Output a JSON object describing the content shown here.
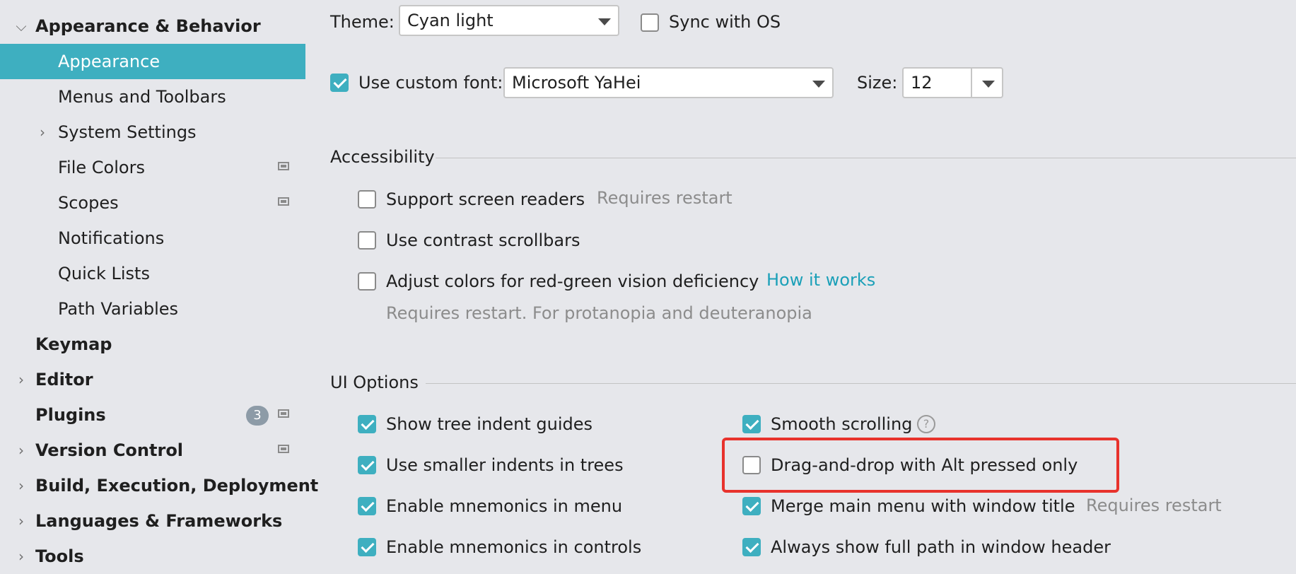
{
  "sidebar": {
    "items": [
      {
        "label": "Appearance & Behavior",
        "expander": "expanded"
      },
      {
        "label": "Appearance"
      },
      {
        "label": "Menus and Toolbars"
      },
      {
        "label": "System Settings",
        "expander": "collapsed"
      },
      {
        "label": "File Colors"
      },
      {
        "label": "Scopes"
      },
      {
        "label": "Notifications"
      },
      {
        "label": "Quick Lists"
      },
      {
        "label": "Path Variables"
      },
      {
        "label": "Keymap"
      },
      {
        "label": "Editor",
        "expander": "collapsed"
      },
      {
        "label": "Plugins",
        "badge": "3"
      },
      {
        "label": "Version Control",
        "expander": "collapsed"
      },
      {
        "label": "Build, Execution, Deployment",
        "expander": "collapsed"
      },
      {
        "label": "Languages & Frameworks",
        "expander": "collapsed"
      },
      {
        "label": "Tools",
        "expander": "collapsed"
      }
    ],
    "arrow_expanded": "⌵",
    "arrow_collapsed": "›"
  },
  "theme": {
    "label": "Theme:",
    "value": "Cyan light",
    "sync_label": "Sync with OS",
    "sync_checked": false
  },
  "font": {
    "label": "Use custom font:",
    "checked": true,
    "value": "Microsoft YaHei",
    "size_label": "Size:",
    "size_value": "12"
  },
  "accessibility": {
    "title": "Accessibility",
    "screen_readers": {
      "label": "Support screen readers",
      "hint": "Requires restart",
      "checked": false
    },
    "contrast_scrollbars": {
      "label": "Use contrast scrollbars",
      "checked": false
    },
    "color_adjust": {
      "label": "Adjust colors for red-green vision deficiency",
      "link": "How it works",
      "hint": "Requires restart. For protanopia and deuteranopia",
      "checked": false
    }
  },
  "ui_options": {
    "title": "UI Options",
    "left": [
      {
        "label": "Show tree indent guides",
        "checked": true
      },
      {
        "label": "Use smaller indents in trees",
        "checked": true
      },
      {
        "label": "Enable mnemonics in menu",
        "checked": true
      },
      {
        "label": "Enable mnemonics in controls",
        "checked": true
      }
    ],
    "right": [
      {
        "label": "Smooth scrolling",
        "checked": true,
        "help": "?"
      },
      {
        "label": "Drag-and-drop with Alt pressed only",
        "checked": false
      },
      {
        "label": "Merge main menu with window title",
        "checked": true,
        "hint": "Requires restart"
      },
      {
        "label": "Always show full path in window header",
        "checked": true
      }
    ]
  },
  "colors": {
    "accent": "#3eafc0",
    "highlight": "#e8322c",
    "link": "#1ba0b8",
    "background": "#e6e7eb"
  }
}
